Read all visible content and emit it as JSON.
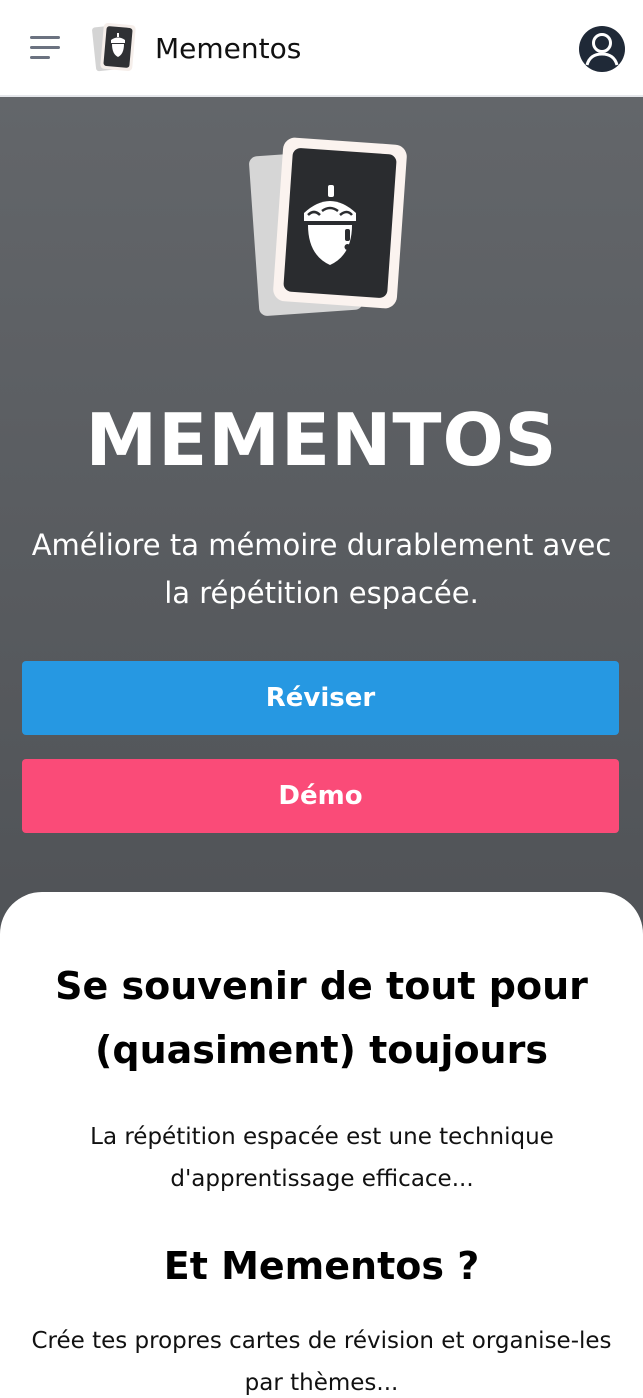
{
  "header": {
    "app_name": "Mementos",
    "menu_icon": "menu-icon",
    "logo_icon": "acorn-card-logo-icon",
    "account_icon": "user-account-icon"
  },
  "hero": {
    "logo_icon": "acorn-card-logo-icon",
    "title": "MEMENTOS",
    "subtitle": "Améliore ta mémoire durablement avec la répétition espacée.",
    "review_button": "Réviser",
    "demo_button": "Démo"
  },
  "content": {
    "heading_1": "Se souvenir de tout pour (quasiment) toujours",
    "paragraph_1": "La répétition espacée est une technique d'apprentissage efficace...",
    "heading_2": "Et Mementos ?",
    "paragraph_2": "Crée tes propres cartes de révision et organise-les par thèmes..."
  },
  "colors": {
    "review_button": "#2698e2",
    "demo_button": "#fa4b78",
    "hero_background": "#5a5d61",
    "avatar": "#1f2937"
  }
}
